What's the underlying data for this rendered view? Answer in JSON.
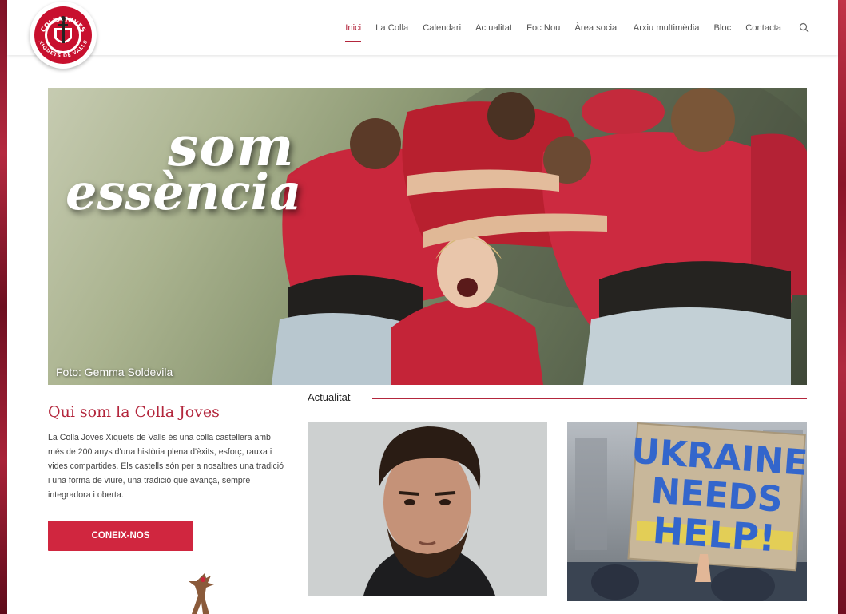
{
  "brand": {
    "logo_alt": "Colla Joves Xiquets de Valls",
    "logo_top_text": "COLLA JOVES",
    "logo_bottom_text": "XIQUETS DE VALLS",
    "accent": "#b3263c"
  },
  "nav": {
    "items": [
      {
        "label": "Inici",
        "active": true
      },
      {
        "label": "La Colla",
        "active": false
      },
      {
        "label": "Calendari",
        "active": false
      },
      {
        "label": "Actualitat",
        "active": false
      },
      {
        "label": "Foc Nou",
        "active": false
      },
      {
        "label": "Àrea social",
        "active": false
      },
      {
        "label": "Arxiu multimèdia",
        "active": false
      },
      {
        "label": "Bloc",
        "active": false
      },
      {
        "label": "Contacta",
        "active": false
      }
    ],
    "search_icon": "search-icon"
  },
  "hero": {
    "title_line1": "som",
    "title_line2": "essència",
    "photo_credit": "Foto: Gemma Soldevila"
  },
  "about": {
    "title": "Qui som la Colla Joves",
    "text": "La Colla Joves Xiquets de Valls és una colla castellera amb més de 200 anys d'una història plena d'èxits, esforç, rauxa i vides compartides. Els castells són per a nosaltres una tradició i una forma de viure, una tradició que avança, sempre integradora i oberta.",
    "button_label": "CONEIX-NOS"
  },
  "news": {
    "label": "Actualitat",
    "cards": [
      {
        "image": "portrait of a bearded man"
      },
      {
        "image": "protest sign",
        "sign_lines": [
          "UKRAINE",
          "NEEDS",
          "HELP!"
        ]
      }
    ]
  }
}
